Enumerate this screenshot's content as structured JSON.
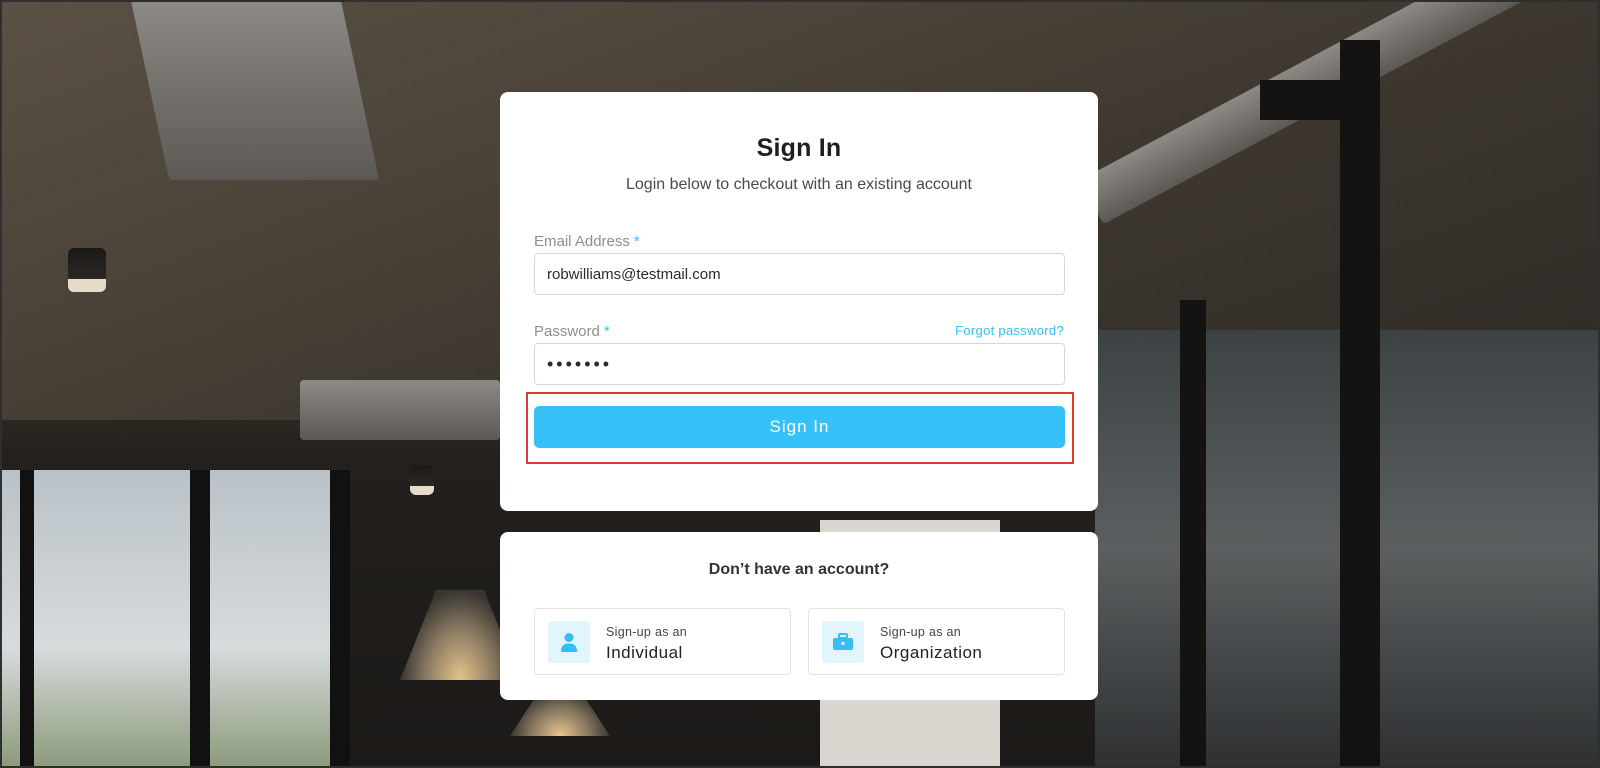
{
  "signin": {
    "title": "Sign In",
    "subtitle": "Login below to checkout with an existing account",
    "email_label": "Email Address",
    "password_label": "Password",
    "required_mark": "*",
    "email_value": "robwilliams@testmail.com",
    "password_value": "•••••••",
    "forgot_label": "Forgot password?",
    "submit_label": "Sign In"
  },
  "signup": {
    "question": "Don’t have an account?",
    "options": [
      {
        "small": "Sign-up as an",
        "big": "Individual",
        "icon": "person-icon"
      },
      {
        "small": "Sign-up as an",
        "big": "Organization",
        "icon": "briefcase-icon"
      }
    ]
  },
  "colors": {
    "accent": "#36c2f8",
    "highlight": "#e0392e"
  }
}
